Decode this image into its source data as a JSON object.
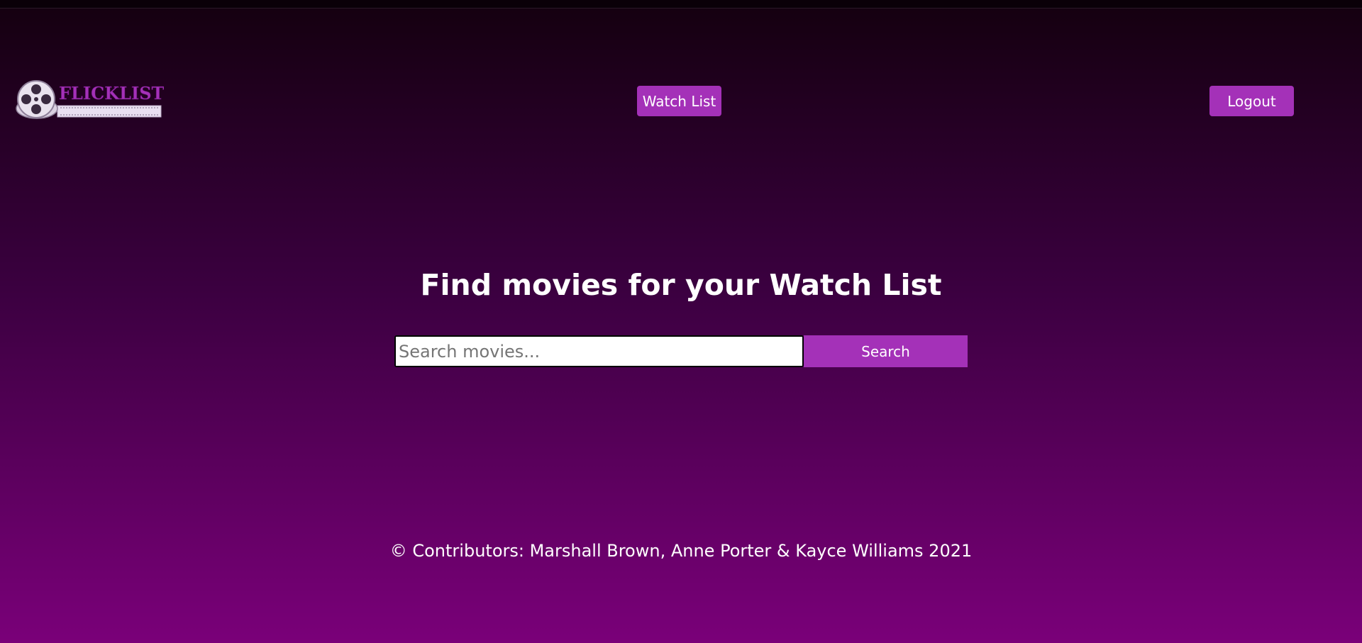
{
  "header": {
    "logo_text": "FlickList",
    "watchlist_label": "Watch List",
    "logout_label": "Logout"
  },
  "main": {
    "title": "Find movies for your Watch List",
    "search": {
      "placeholder": "Search movies...",
      "value": "",
      "button_label": "Search"
    }
  },
  "footer": {
    "text": "© Contributors: Marshall Brown, Anne Porter & Kayce Williams 2021"
  },
  "colors": {
    "accent": "#a431b8",
    "background_top": "#14000f",
    "background_bottom": "#7a0079"
  },
  "icons": {
    "logo": "film-reel-icon"
  }
}
